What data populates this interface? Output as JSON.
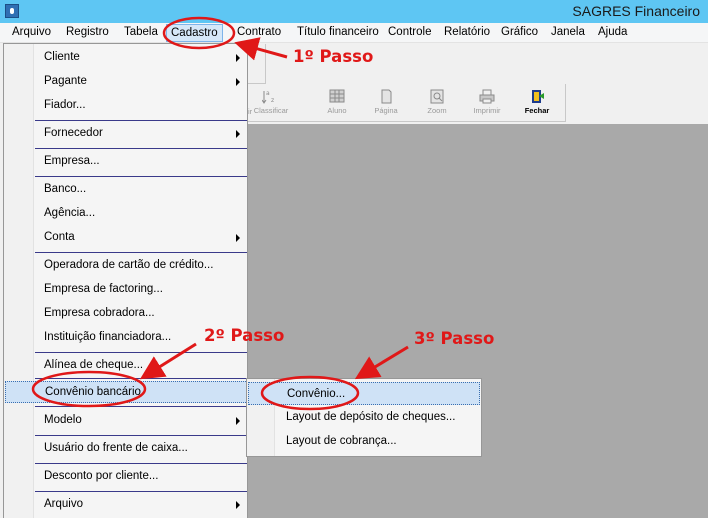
{
  "window": {
    "title": "SAGRES Financeiro"
  },
  "menubar": {
    "items": [
      "Arquivo",
      "Registro",
      "Tabela",
      "Cadastro",
      "Contrato",
      "Título financeiro",
      "Controle",
      "Relatório",
      "Gráfico",
      "Janela",
      "Ajuda"
    ],
    "active": "Cadastro"
  },
  "toolbar": {
    "clipped_label": "ir",
    "buttons": [
      {
        "label": "Classificar",
        "icon": "sort-az-icon",
        "enabled": false
      },
      {
        "label": "Aluno",
        "icon": "grid-icon",
        "enabled": false
      },
      {
        "label": "Página",
        "icon": "page-icon",
        "enabled": false
      },
      {
        "label": "Zoom",
        "icon": "zoom-icon",
        "enabled": false
      },
      {
        "label": "Imprimir",
        "icon": "printer-icon",
        "enabled": false
      },
      {
        "label": "Fechar",
        "icon": "close-door-icon",
        "enabled": true
      }
    ]
  },
  "cadastro_menu": {
    "items": [
      {
        "label": "Cliente",
        "submenu": true
      },
      {
        "label": "Pagante",
        "submenu": true
      },
      {
        "label": "Fiador...",
        "submenu": false
      },
      {
        "label": "Fornecedor",
        "submenu": true
      },
      {
        "label": "Empresa...",
        "submenu": false
      },
      {
        "label": "Banco...",
        "submenu": false
      },
      {
        "label": "Agência...",
        "submenu": false
      },
      {
        "label": "Conta",
        "submenu": true
      },
      {
        "label": "Operadora de cartão de crédito...",
        "submenu": false
      },
      {
        "label": "Empresa de factoring...",
        "submenu": false
      },
      {
        "label": "Empresa cobradora...",
        "submenu": false
      },
      {
        "label": "Instituição financiadora...",
        "submenu": false
      },
      {
        "label": "Alínea de cheque...",
        "submenu": false
      },
      {
        "label": "Convênio bancário",
        "submenu": true,
        "selected": true
      },
      {
        "label": "Modelo",
        "submenu": true
      },
      {
        "label": "Usuário do frente de caixa...",
        "submenu": false
      },
      {
        "label": "Desconto por cliente...",
        "submenu": false
      },
      {
        "label": "Arquivo",
        "submenu": true
      }
    ]
  },
  "convenio_submenu": {
    "items": [
      {
        "label": "Convênio...",
        "selected": true
      },
      {
        "label": "Layout de depósito de cheques..."
      },
      {
        "label": "Layout de cobrança..."
      }
    ]
  },
  "annotations": {
    "step1": "1º Passo",
    "step2": "2º Passo",
    "step3": "3º Passo",
    "color": "#e01818"
  },
  "colors": {
    "titlebar": "#5ec6f3",
    "workspace": "#a9a9a9",
    "highlight": "#cfe2f6"
  }
}
